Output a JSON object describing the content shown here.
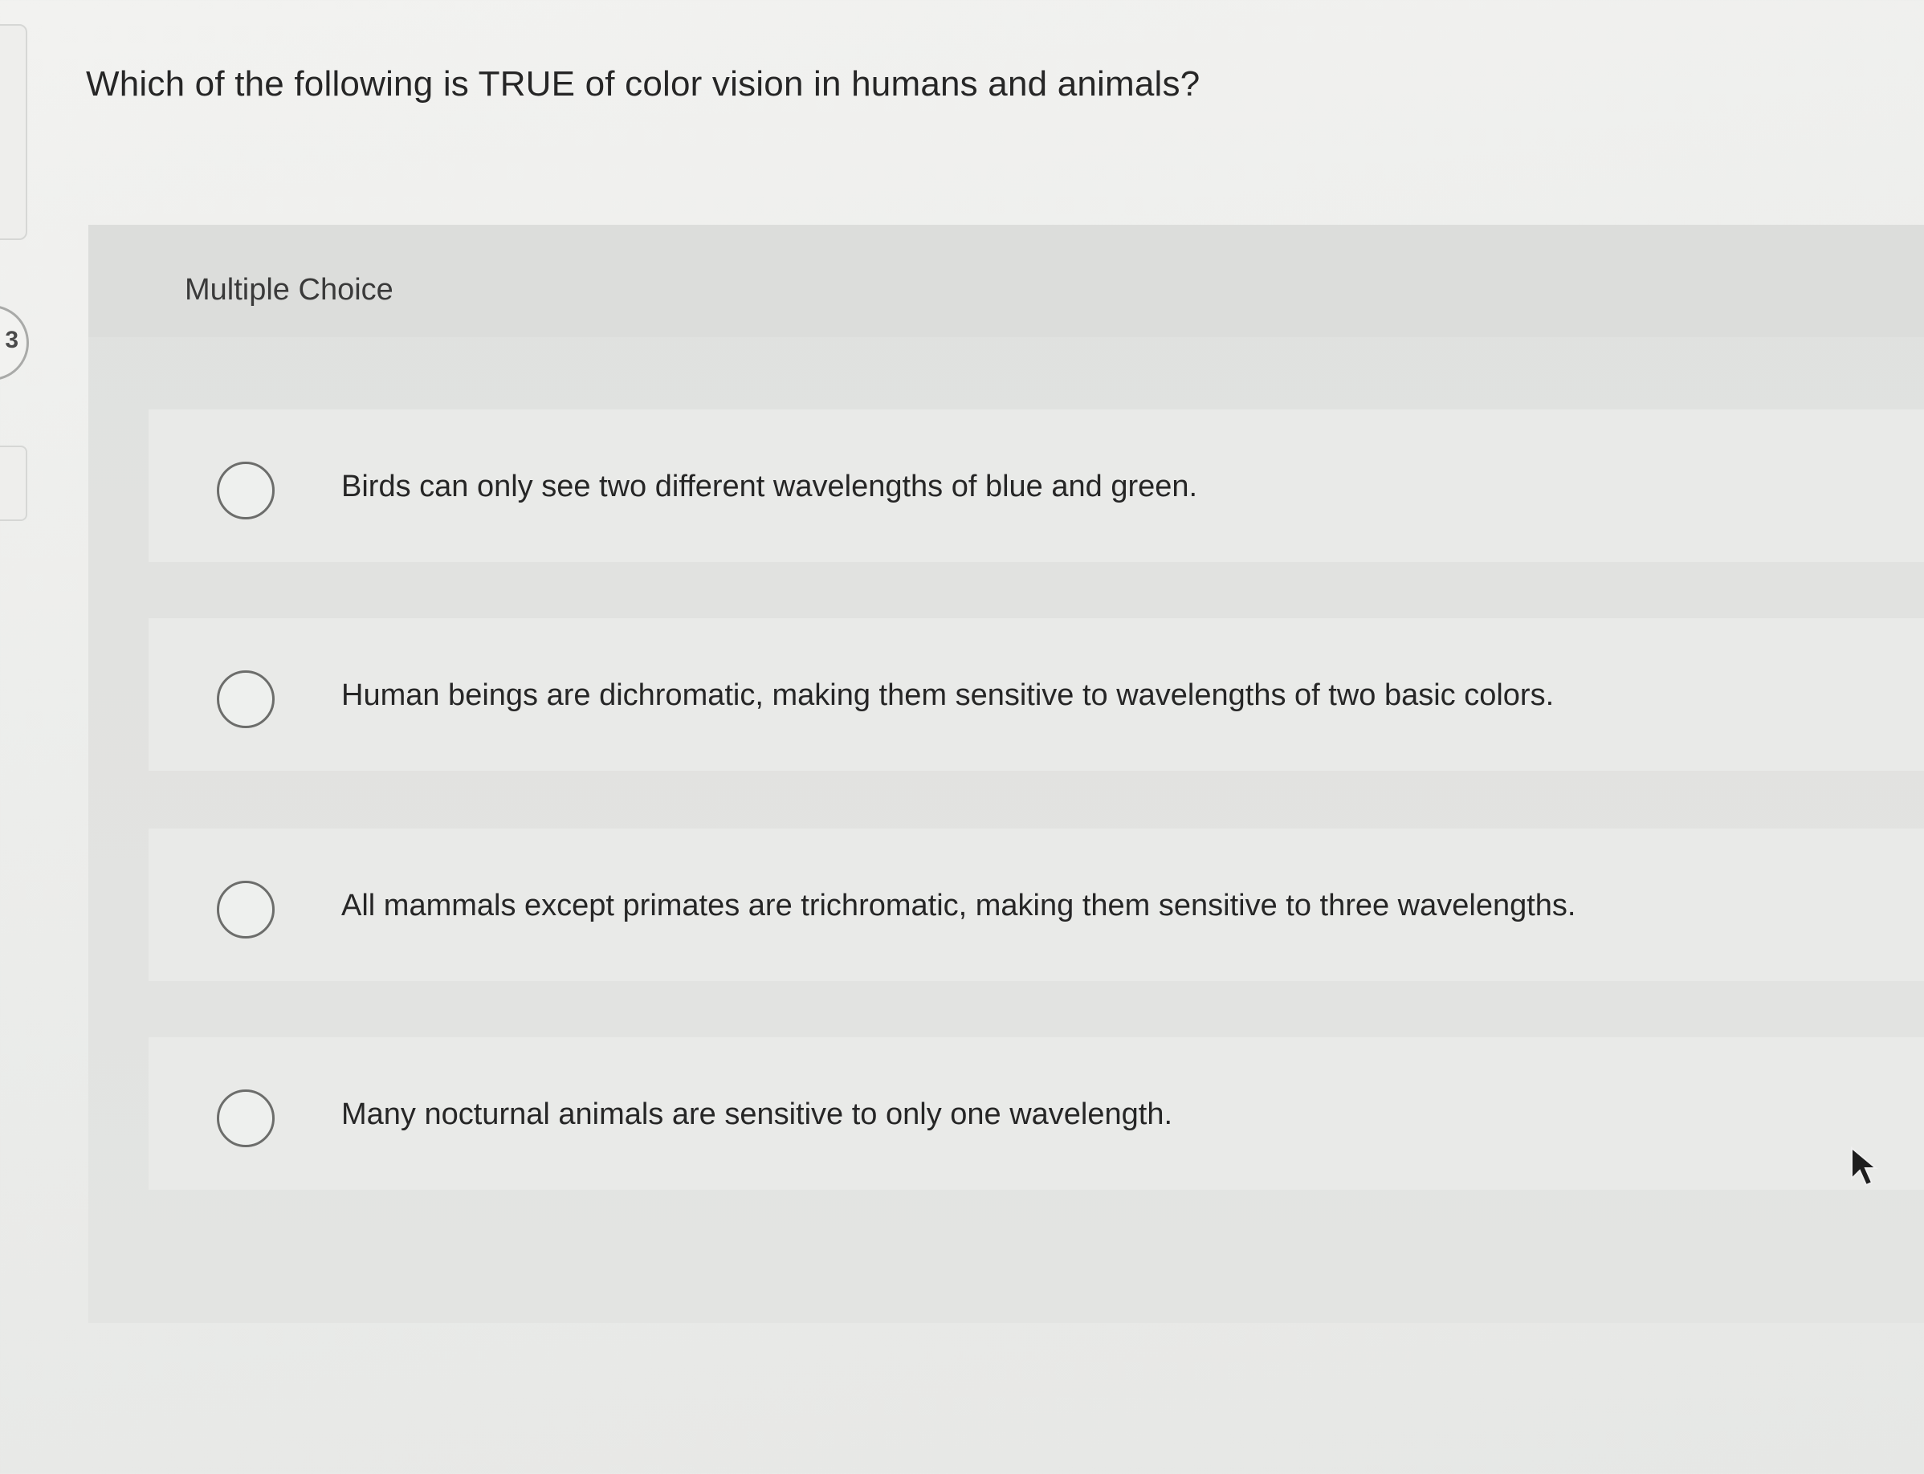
{
  "rail": {
    "badge_number": "3"
  },
  "question": {
    "text": "Which of the following is TRUE of color vision in humans and animals?"
  },
  "choice_panel": {
    "type_label": "Multiple Choice",
    "options": [
      {
        "label": "Birds can only see two different wavelengths of blue and green.",
        "selected": false
      },
      {
        "label": "Human beings are dichromatic, making them sensitive to wavelengths of two basic colors.",
        "selected": false
      },
      {
        "label": "All mammals except primates are trichromatic, making them sensitive to three wavelengths.",
        "selected": false
      },
      {
        "label": "Many nocturnal animals are sensitive to only one wavelength.",
        "selected": false
      }
    ]
  },
  "icons": {
    "cursor": "mouse-pointer-icon",
    "option_marker": "radio-button-icon"
  },
  "colors": {
    "background": "#ecedeb",
    "panel": "#e1e2e0",
    "option_row": "#e9eae8",
    "text": "#262626",
    "radio_border": "#6c6d6b"
  }
}
